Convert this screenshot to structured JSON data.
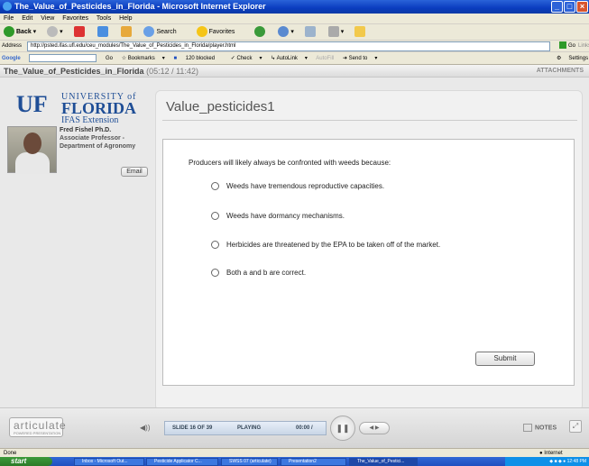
{
  "window": {
    "title": "The_Value_of_Pesticides_in_Florida - Microsoft Internet Explorer"
  },
  "menu": [
    "File",
    "Edit",
    "View",
    "Favorites",
    "Tools",
    "Help"
  ],
  "toolbar": {
    "back": "Back",
    "search": "Search",
    "favorites": "Favorites"
  },
  "address": {
    "label": "Address",
    "url": "http://psted.ifas.ufl.edu/ceu_modules/The_Value_of_Pesticides_in_Florida/player.html",
    "go": "Go",
    "links": "Links"
  },
  "googlebar": {
    "logo": "Google",
    "go": "Go",
    "bookmarks": "Bookmarks",
    "blocked": "120 blocked",
    "check": "Check",
    "autolink": "AutoLink",
    "autofill": "AutoFill",
    "sendto": "Send to",
    "settings": "Settings"
  },
  "player": {
    "course_title": "The_Value_of_Pesticides_in_Florida",
    "time": "(05:12 / 11:42)",
    "attachments": "ATTACHMENTS"
  },
  "sidebar": {
    "uf": "UF",
    "university_of": "UNIVERSITY of",
    "florida": "FLORIDA",
    "ifas": "IFAS Extension",
    "presenter_name": "Fred Fishel Ph.D.",
    "presenter_title1": "Associate Professor -",
    "presenter_title2": "Department of Agronomy",
    "email": "Email"
  },
  "slide": {
    "title": "Value_pesticides1",
    "question": "Producers will likely always be confronted with weeds because:",
    "options": [
      "Weeds have tremendous reproductive capacities.",
      "Weeds have dormancy mechanisms.",
      "Herbicides are threatened by the EPA to be taken off of the market.",
      "Both a and b are correct."
    ],
    "submit": "Submit"
  },
  "controls": {
    "articulate": "articulate",
    "articulate_sub": "POWERED PRESENTATION",
    "slide_counter": "SLIDE 16 OF 39",
    "status": "PLAYING",
    "elapsed": "00:00 /",
    "notes": "NOTES"
  },
  "statusbar": {
    "left": "Done",
    "zone": "Internet"
  },
  "taskbar": {
    "start": "start",
    "tasks": [
      "Inbox - Microsoft Out...",
      "Pesticide Applicator C...",
      "SWSS 07 (articulate)",
      "Presentation2",
      "The_Value_of_Pestici..."
    ],
    "clock": "12:48 PM"
  }
}
